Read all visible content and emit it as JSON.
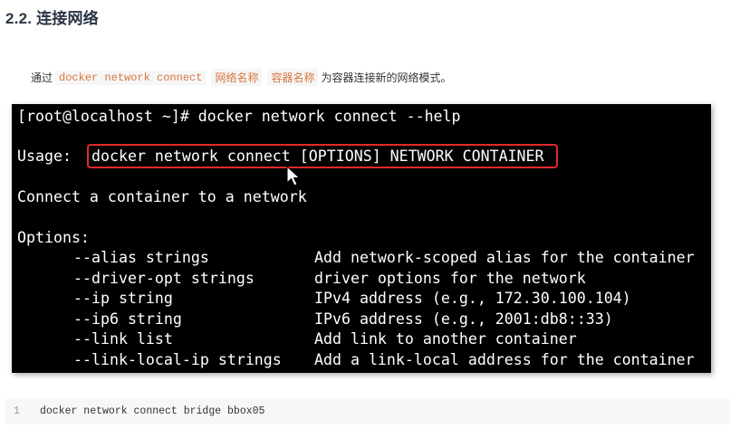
{
  "heading": "2.2. 连接网络",
  "intro": {
    "prefix": "通过",
    "code_cmd": "docker network connect",
    "code_net": "网络名称",
    "code_container": "容器名称",
    "suffix": "为容器连接新的网络模式。"
  },
  "terminal": {
    "prompt_line": "[root@localhost ~]# docker network connect --help",
    "usage_label": "Usage:",
    "usage_cmd": "docker network connect [OPTIONS] NETWORK CONTAINER",
    "description": "Connect a container to a network",
    "options_header": "Options:",
    "options": [
      {
        "flag": "--alias strings",
        "desc": "Add network-scoped alias for the container"
      },
      {
        "flag": "--driver-opt strings",
        "desc": "driver options for the network"
      },
      {
        "flag": "--ip string",
        "desc": "IPv4 address (e.g., 172.30.100.104)"
      },
      {
        "flag": "--ip6 string",
        "desc": "IPv6 address (e.g., 2001:db8::33)"
      },
      {
        "flag": "--link list",
        "desc": "Add link to another container"
      },
      {
        "flag": "--link-local-ip strings",
        "desc": "Add a link-local address for the container"
      }
    ],
    "highlight_color": "#e02b2b",
    "cursor_icon": "mouse-pointer-icon"
  },
  "code_block": {
    "line_number": "1",
    "code": "docker network connect bridge bbox05"
  }
}
